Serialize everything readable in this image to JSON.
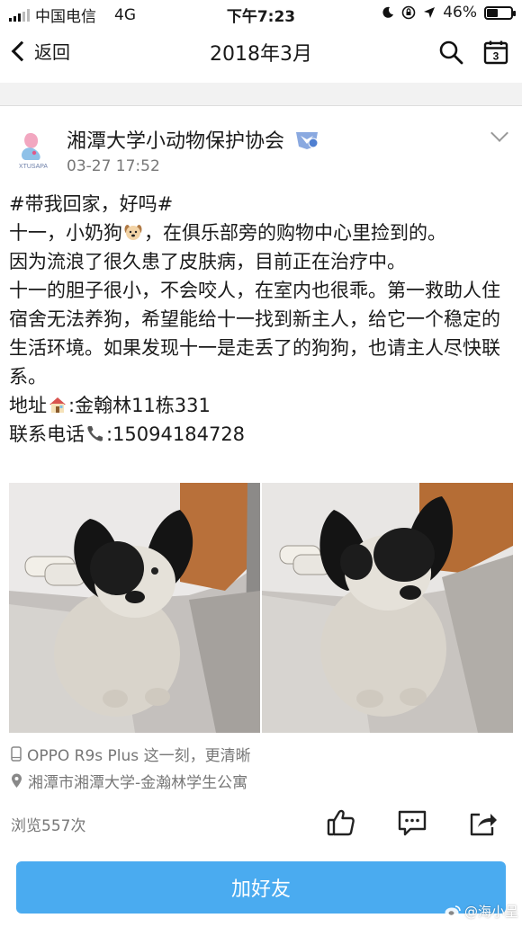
{
  "status_bar": {
    "carrier": "中国电信",
    "network": "4G",
    "time": "下午7:23",
    "battery": "46%",
    "battery_level": 0.46
  },
  "nav": {
    "back_label": "返回",
    "title": "2018年3月",
    "calendar_day": "3"
  },
  "post": {
    "avatar_text": "XTUSAPA",
    "author": "湘潭大学小动物保护协会",
    "time": "03-27 17:52",
    "line_1": "#带我回家，好吗#",
    "line_2_a": "十一，小奶狗",
    "line_2_b": "，在俱乐部旁的购物中心里捡到的。",
    "line_3": "因为流浪了很久患了皮肤病，目前正在治疗中。",
    "line_4": "十一的胆子很小，不会咬人，在室内也很乖。第一救助人住宿舍无法养狗，希望能给十一找到新主人，给它一个稳定的生活环境。如果发现十一是走丢了的狗狗，也请主人尽快联系。",
    "address_label": "地址",
    "address_value": ":金翰林11栋331",
    "phone_label": "联系电话",
    "phone_value": ":15094184728",
    "device": "OPPO R9s Plus 这一刻，更清晰",
    "location": "湘潭市湘潭大学-金瀚林学生公寓",
    "views": "浏览557次"
  },
  "add_friend_button": "加好友",
  "watermark": "@海小呈",
  "colors": {
    "accent": "#4aabf0",
    "secondary_text": "#777777",
    "band": "#f2f2f2"
  },
  "icons": [
    "signal-icon",
    "moon-icon",
    "lock-rotation-icon",
    "location-arrow-icon",
    "battery-icon",
    "back-chevron-icon",
    "search-icon",
    "calendar-icon",
    "verified-badge-icon",
    "chevron-down-icon",
    "dog-emoji-icon",
    "house-emoji-icon",
    "phone-emoji-icon",
    "phone-device-icon",
    "map-pin-icon",
    "thumbs-up-icon",
    "comment-icon",
    "share-icon",
    "weibo-logo-icon"
  ]
}
